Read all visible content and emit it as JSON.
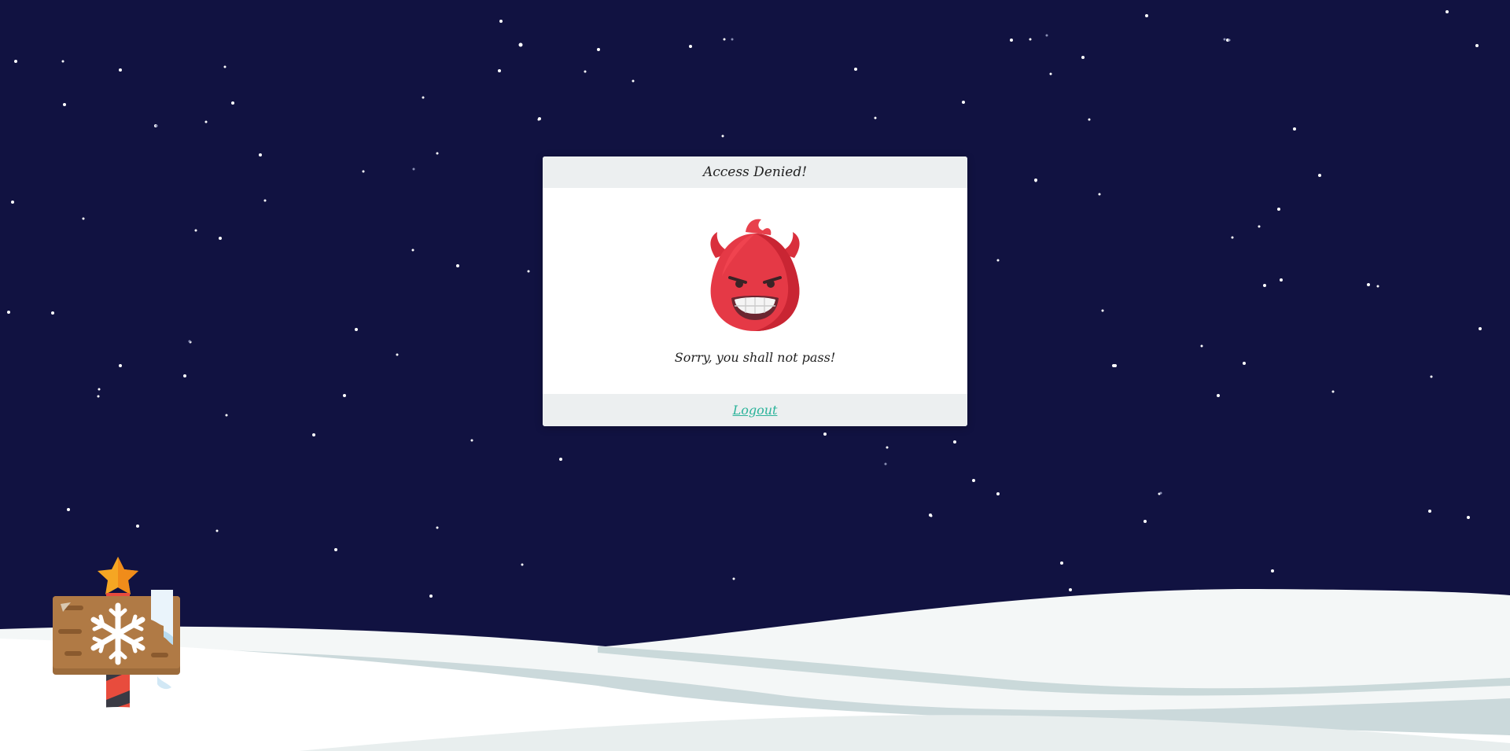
{
  "dialog": {
    "title": "Access Denied!",
    "message": "Sorry, you shall not pass!",
    "logout_label": "Logout",
    "mascot_icon": "devil-face-icon"
  },
  "scene": {
    "background_color": "#111241",
    "decoration_icon": "snowflake-signpost-icon"
  },
  "colors": {
    "card": "#ffffff",
    "card_bar": "#eceff0",
    "link": "#2bb39a",
    "devil": "#f0434f"
  }
}
